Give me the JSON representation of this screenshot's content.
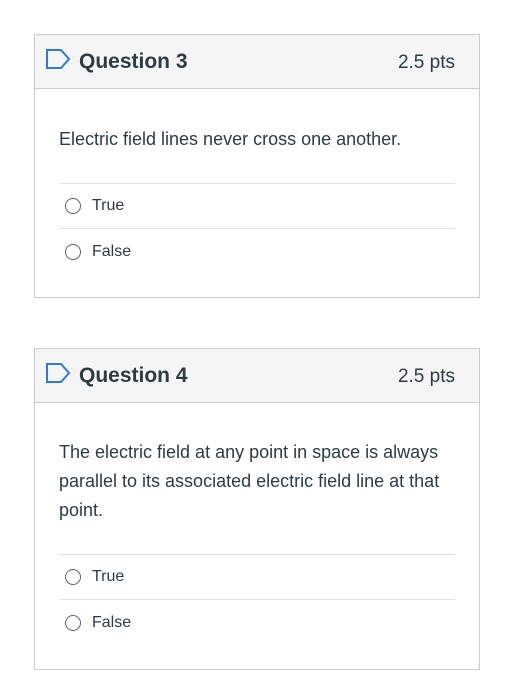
{
  "colors": {
    "border": "#c7cdd1",
    "header_bg": "#f5f5f5",
    "flag": "#2d7bd4",
    "text": "#2d3b45"
  },
  "questions": [
    {
      "title": "Question 3",
      "points": "2.5 pts",
      "text": "Electric field lines never cross one another.",
      "answers": [
        {
          "label": "True",
          "selected": false
        },
        {
          "label": "False",
          "selected": false
        }
      ]
    },
    {
      "title": "Question 4",
      "points": "2.5 pts",
      "text": "The electric field at any point in space is always parallel to its associated electric field line at that point.",
      "answers": [
        {
          "label": "True",
          "selected": false
        },
        {
          "label": "False",
          "selected": false
        }
      ]
    }
  ]
}
